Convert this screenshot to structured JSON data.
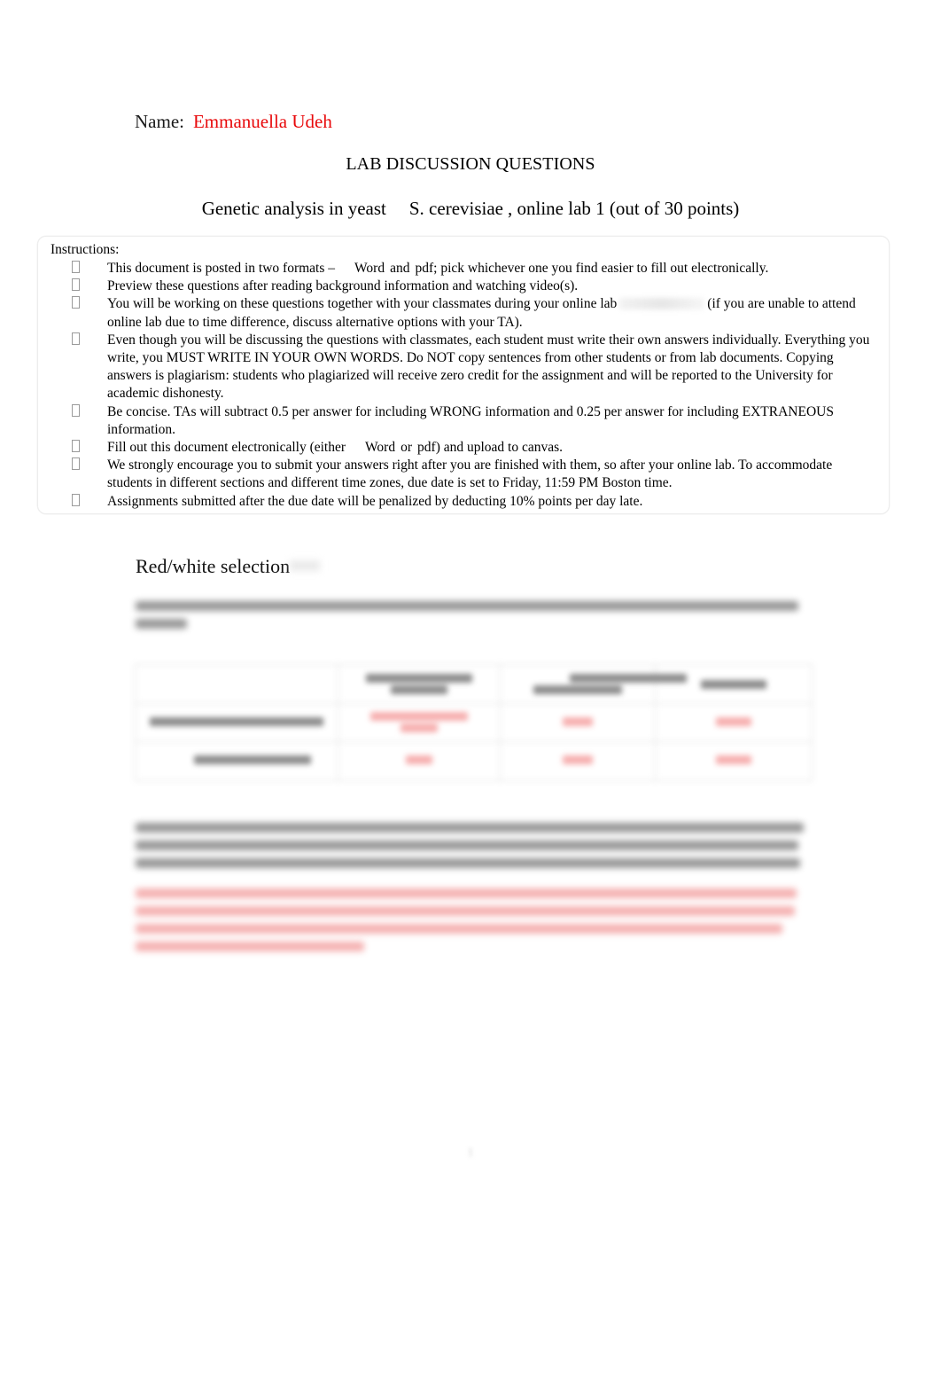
{
  "document": {
    "name_label": "Name:",
    "student_name": "Emmanuella Udeh",
    "title": "LAB DISCUSSION QUESTIONS",
    "subtitle_part1": "Genetic analysis in yeast",
    "subtitle_species": "S. cerevisiae",
    "subtitle_part2": ", online lab 1 (out of 30 points)",
    "page_number": "1"
  },
  "instructions": {
    "heading": "Instructions:",
    "items": [
      {
        "text_before": "This document is posted in two formats –",
        "word1": "Word",
        "mid": "and",
        "word2": "pdf;",
        "text_after": "pick whichever one you find easier to fill out electronically."
      },
      {
        "text": "Preview these questions after reading background information and watching video(s)."
      },
      {
        "text_before": "You will be working on these questions together with your classmates during your online lab",
        "redacted": true,
        "text_after": "(if you are unable to attend online lab due to time difference, discuss alternative options with your TA)."
      },
      {
        "text": "Even though you will be discussing the questions with classmates, each student must write their own answers individually. Everything you write, you MUST WRITE IN YOUR OWN WORDS. Do NOT copy sentences from other students or from lab documents. Copying answers is plagiarism: students who plagiarized will receive zero credit for the assignment and will be reported to the University for academic dishonesty."
      },
      {
        "text": "Be concise. TAs will subtract 0.5 per answer for including WRONG information and 0.25 per answer for including EXTRANEOUS information."
      },
      {
        "text_before": "Fill out this document electronically (either",
        "word1": "Word",
        "mid": "or",
        "word2": "pdf",
        "text_after": ") and upload to canvas."
      },
      {
        "text": "We strongly encourage you to submit your answers right after you are finished with them, so after your online lab. To accommodate students in different sections and different time zones, due date is set to Friday, 11:59 PM Boston time."
      },
      {
        "text": "Assignments submitted after the due date will be penalized by deducting 10% points per day late."
      }
    ]
  },
  "section": {
    "heading": "Red/white selection"
  },
  "redacted_content": {
    "question_1_note": "blurred/illegible question text",
    "table_note": "blurred/illegible table with red answer entries",
    "question_2_note": "blurred/illegible question text",
    "answer_note": "blurred/illegible red highlighted answer text"
  },
  "colors": {
    "name_red": "#e8090b",
    "answer_highlight": "#f5a0a0",
    "box_border": "#ededed"
  }
}
